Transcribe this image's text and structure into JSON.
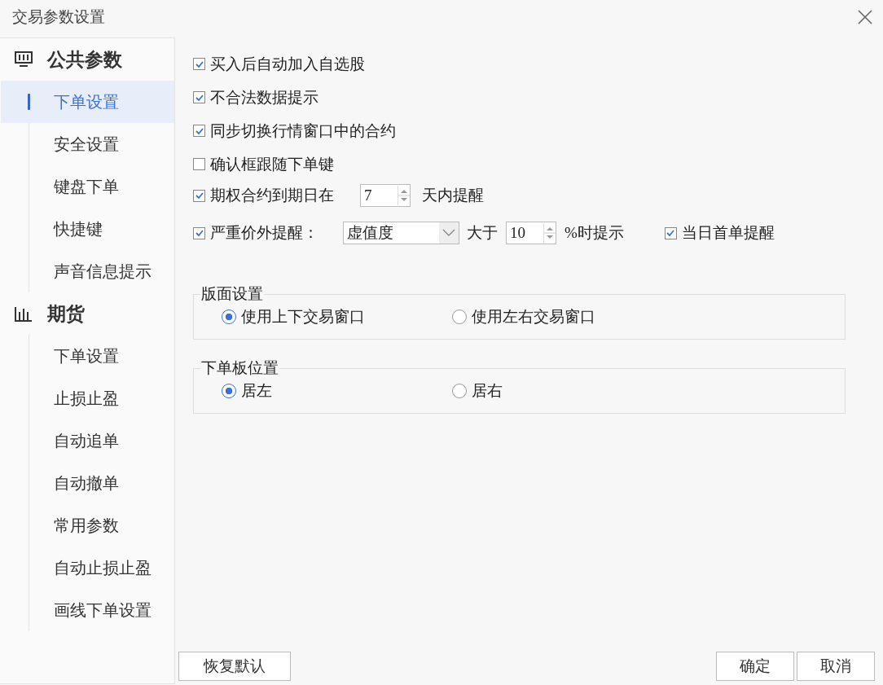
{
  "window": {
    "title": "交易参数设置"
  },
  "sidebar": {
    "groups": [
      {
        "kind": "monitor",
        "title": "公共参数",
        "items": [
          {
            "label": "下单设置",
            "selected": true
          },
          {
            "label": "安全设置",
            "selected": false
          },
          {
            "label": "键盘下单",
            "selected": false
          },
          {
            "label": "快捷键",
            "selected": false
          },
          {
            "label": "声音信息提示",
            "selected": false
          }
        ]
      },
      {
        "kind": "chart",
        "title": "期货",
        "items": [
          {
            "label": "下单设置",
            "selected": false
          },
          {
            "label": "止损止盈",
            "selected": false
          },
          {
            "label": "自动追单",
            "selected": false
          },
          {
            "label": "自动撤单",
            "selected": false
          },
          {
            "label": "常用参数",
            "selected": false
          },
          {
            "label": "自动止损止盈",
            "selected": false
          },
          {
            "label": "画线下单设置",
            "selected": false
          }
        ]
      }
    ]
  },
  "options": [
    {
      "kind": "checkbox",
      "label": "买入后自动加入自选股",
      "checked": true
    },
    {
      "kind": "checkbox",
      "label": "不合法数据提示",
      "checked": true
    },
    {
      "kind": "checkbox",
      "label": "同步切换行情窗口中的合约",
      "checked": true
    },
    {
      "kind": "checkbox",
      "label": "确认框跟随下单键",
      "checked": false
    },
    {
      "kind": "days",
      "label": "期权合约到期日在",
      "checked": true,
      "value": "7",
      "suffix": "天内提醒"
    },
    {
      "kind": "threshold",
      "label": "严重价外提醒：",
      "checked": true,
      "select": "虚值度",
      "between": "大于",
      "value": "10",
      "suffix": "%时提示",
      "extra": {
        "label": "当日首单提醒",
        "checked": true
      }
    }
  ],
  "groups": [
    {
      "title": "版面设置",
      "options": [
        {
          "label": "使用上下交易窗口",
          "selected": true
        },
        {
          "label": "使用左右交易窗口",
          "selected": false
        }
      ]
    },
    {
      "title": "下单板位置",
      "options": [
        {
          "label": "居左",
          "selected": true
        },
        {
          "label": "居右",
          "selected": false
        }
      ]
    }
  ],
  "buttons": {
    "restore": "恢复默认",
    "ok": "确定",
    "cancel": "取消"
  }
}
